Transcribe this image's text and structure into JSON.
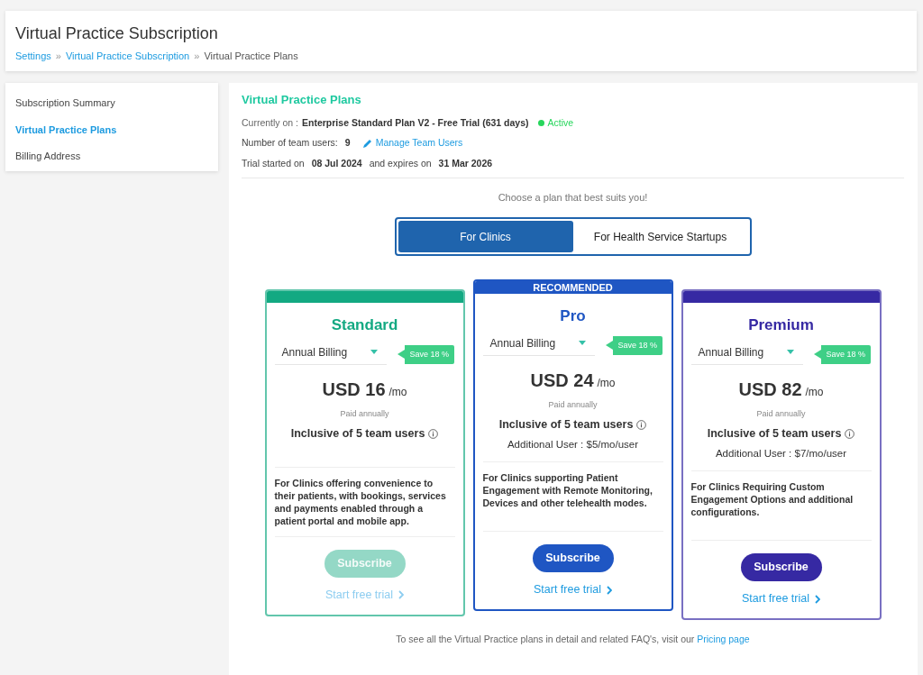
{
  "header": {
    "title": "Virtual Practice Subscription",
    "breadcrumbs": [
      {
        "label": "Settings",
        "link": true
      },
      {
        "label": "Virtual Practice Subscription",
        "link": true
      },
      {
        "label": "Virtual Practice Plans",
        "link": false
      }
    ],
    "separator": "»"
  },
  "sidebar": {
    "items": [
      {
        "label": "Subscription Summary",
        "selected": false
      },
      {
        "label": "Virtual Practice Plans",
        "selected": true
      },
      {
        "label": "Billing Address",
        "selected": false
      }
    ]
  },
  "main": {
    "title": "Virtual Practice Plans",
    "current_label": "Currently on :",
    "current_plan": "Enterprise Standard Plan V2 - Free Trial (631 days)",
    "status": "Active",
    "users_label": "Number of team users:",
    "users_count": "9",
    "manage_link": "Manage Team Users",
    "trial_label": "Trial started on",
    "trial_start": "08 Jul 2024",
    "expires_label": "and expires on",
    "trial_end": "31 Mar 2026",
    "choose_text": "Choose a plan that best suits you!",
    "tabs": [
      {
        "label": "For Clinics",
        "selected": true
      },
      {
        "label": "For Health Service Startups",
        "selected": false
      }
    ],
    "plans": [
      {
        "name": "Standard",
        "color": "#13a982",
        "billing": "Annual Billing",
        "save": "Save 18 %",
        "price": "USD 16",
        "per": "/mo",
        "paid": "Paid annually",
        "inclusive": "Inclusive of 5 team users",
        "description": "For Clinics offering convenience to their patients, with bookings, services and payments enabled through a patient portal and mobile app.",
        "subscribe": "Subscribe",
        "disabled": true,
        "trial": "Start free trial"
      },
      {
        "name": "Pro",
        "color": "#1f56c3",
        "banner": "RECOMMENDED",
        "billing": "Annual Billing",
        "save": "Save 18 %",
        "price": "USD 24",
        "per": "/mo",
        "paid": "Paid annually",
        "inclusive": "Inclusive of 5 team users",
        "additional": "Additional User : $5/mo/user",
        "description": "For Clinics supporting Patient Engagement with Remote Monitoring, Devices and other telehealth modes.",
        "subscribe": "Subscribe",
        "disabled": false,
        "trial": "Start free trial"
      },
      {
        "name": "Premium",
        "color": "#3629a3",
        "billing": "Annual Billing",
        "save": "Save 18 %",
        "price": "USD 82",
        "per": "/mo",
        "paid": "Paid annually",
        "inclusive": "Inclusive of 5 team users",
        "additional": "Additional User : $7/mo/user",
        "description": "For Clinics Requiring Custom Engagement Options and additional configurations.",
        "subscribe": "Subscribe",
        "disabled": false,
        "trial": "Start free trial"
      }
    ],
    "footer_text": "To see all the Virtual Practice plans in detail and related FAQ's, visit our",
    "footer_link": "Pricing page"
  }
}
